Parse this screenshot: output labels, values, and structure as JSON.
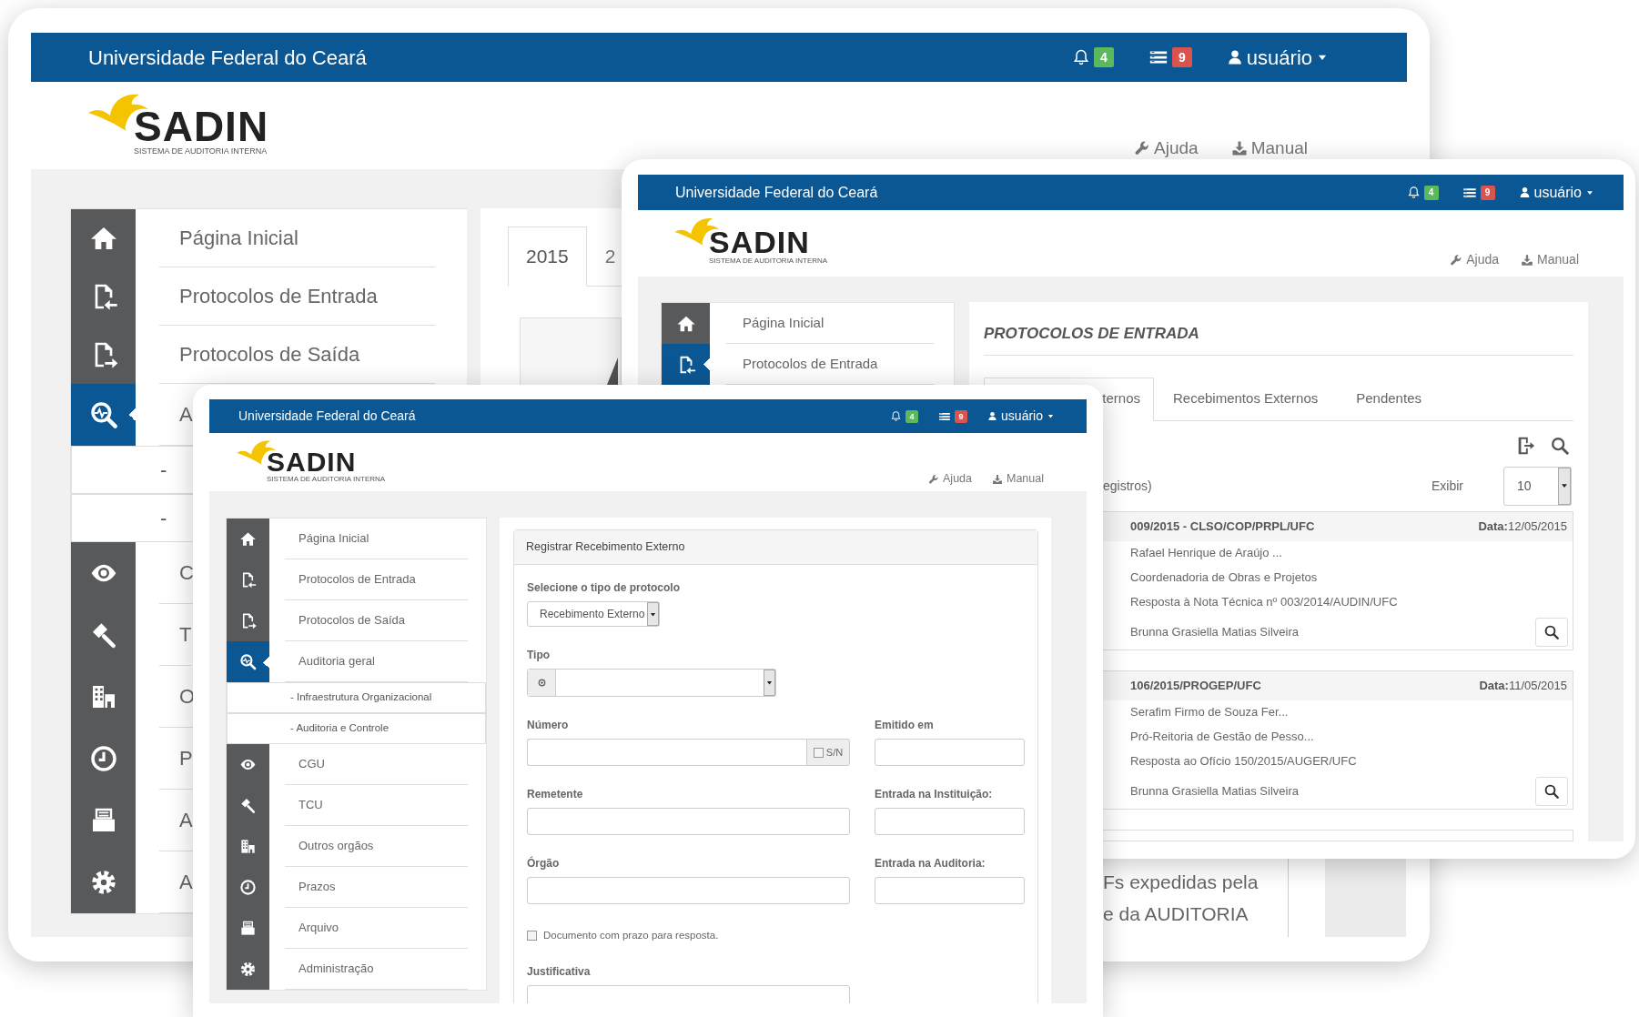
{
  "windows": [
    {
      "kind": "dashboard",
      "header": {
        "title": "Universidade Federal do Ceará",
        "notification_count": "4",
        "message_count": "9",
        "user": "usuário"
      },
      "logo": {
        "name": "SADIN",
        "tagline": "SISTEMA DE AUDITORIA INTERNA"
      },
      "links": [
        {
          "label": "Ajuda"
        },
        {
          "label": "Manual"
        }
      ],
      "menu": [
        {
          "label": "Página Inicial",
          "selected": false
        },
        {
          "label": "Protocolos de Entrada",
          "selected": false
        },
        {
          "label": "Protocolos de Saída",
          "selected": false
        },
        {
          "label": "A",
          "selected": true,
          "children": [
            {
              "label": "-"
            },
            {
              "label": "-"
            }
          ]
        },
        {
          "label": "C",
          "selected": false
        },
        {
          "label": "T",
          "selected": false
        },
        {
          "label": "O",
          "selected": false
        },
        {
          "label": "P",
          "selected": false
        },
        {
          "label": "A",
          "selected": false
        },
        {
          "label": "A",
          "selected": false
        }
      ],
      "year_tabs": [
        {
          "label": "2015",
          "selected": true
        },
        {
          "label": "2",
          "selected": false
        }
      ],
      "notice_lines": [
        "Fs expedidas pela",
        "e da AUDITORIA"
      ]
    },
    {
      "kind": "list",
      "header": {
        "title": "Universidade Federal do Ceará",
        "notification_count": "4",
        "message_count": "9",
        "user": "usuário"
      },
      "logo": {
        "name": "SADIN",
        "tagline": "SISTEMA DE AUDITORIA INTERNA"
      },
      "links": [
        {
          "label": "Ajuda"
        },
        {
          "label": "Manual"
        }
      ],
      "menu": [
        {
          "label": "Página Inicial",
          "selected": false
        },
        {
          "label": "Protocolos de Entrada",
          "selected": true
        }
      ],
      "title": "PROTOCOLOS DE ENTRADA",
      "tabs": [
        {
          "label": "ternos",
          "selected": true
        },
        {
          "label": "Recebimentos Externos",
          "selected": false
        },
        {
          "label": "Pendentes",
          "selected": false
        }
      ],
      "count_text": "egistros)",
      "page_size": {
        "label": "Exibir",
        "value": "10"
      },
      "records": [
        {
          "number": "009/2015 - CLSO/COP/PRPL/UFC",
          "date": "**Data:**12/05/2015",
          "lines": [
            "Rafael Henrique de Araújo ...",
            "Coordenadoria de Obras e Projetos",
            "Resposta à Nota Técnica nº 003/2014/AUDIN/UFC",
            "Brunna Grasiella Matias Silveira"
          ]
        },
        {
          "number": "106/2015/PROGEP/UFC",
          "date": "**Data:**11/05/2015",
          "lines": [
            "Serafim Firmo de Souza Fer...",
            "Pró-Reitoria de Gestão de Pesso...",
            "Resposta ao Ofício 150/2015/AUGER/UFC",
            "Brunna Grasiella Matias Silveira"
          ]
        }
      ]
    },
    {
      "kind": "form",
      "header": {
        "title": "Universidade Federal do Ceará",
        "notification_count": "4",
        "message_count": "9",
        "user": "usuário"
      },
      "logo": {
        "name": "SADIN",
        "tagline": "SISTEMA DE AUDITORIA INTERNA"
      },
      "links": [
        {
          "label": "Ajuda"
        },
        {
          "label": "Manual"
        }
      ],
      "menu": [
        {
          "label": "Página Inicial",
          "selected": false
        },
        {
          "label": "Protocolos de Entrada",
          "selected": false
        },
        {
          "label": "Protocolos de Saída",
          "selected": false
        },
        {
          "label": "Auditoria geral",
          "selected": true,
          "children": [
            {
              "label": "- Infraestrutura Organizacional"
            },
            {
              "label": "- Auditoria e Controle"
            }
          ]
        },
        {
          "label": "CGU",
          "selected": false
        },
        {
          "label": "TCU",
          "selected": false
        },
        {
          "label": "Outros orgãos",
          "selected": false
        },
        {
          "label": "Prazos",
          "selected": false
        },
        {
          "label": "Arquivo",
          "selected": false
        },
        {
          "label": "Administração",
          "selected": false
        }
      ],
      "form": {
        "title": "Registrar Recebimento Externo",
        "rows": [
          [
            {
              "kind": "select",
              "label": "Selecione o tipo de protocolo",
              "value": "Recebimento Externo"
            }
          ],
          [
            {
              "kind": "addon-select",
              "label": "Tipo"
            }
          ],
          [
            {
              "kind": "text-addon",
              "label": "Número",
              "addon": "S/N",
              "checked": false
            },
            {
              "kind": "text",
              "label": "Emitido em"
            }
          ],
          [
            {
              "kind": "text",
              "label": "Remetente"
            },
            {
              "kind": "text",
              "label": "Entrada na Instituição:"
            }
          ],
          [
            {
              "kind": "text",
              "label": "Órgão"
            },
            {
              "kind": "text",
              "label": "Entrada na Auditoria:"
            }
          ],
          [
            {
              "kind": "checkbox",
              "label": "Documento com prazo para resposta.",
              "checked": false
            }
          ],
          [
            {
              "kind": "textarea",
              "label": "Justificativa"
            }
          ]
        ]
      }
    }
  ]
}
